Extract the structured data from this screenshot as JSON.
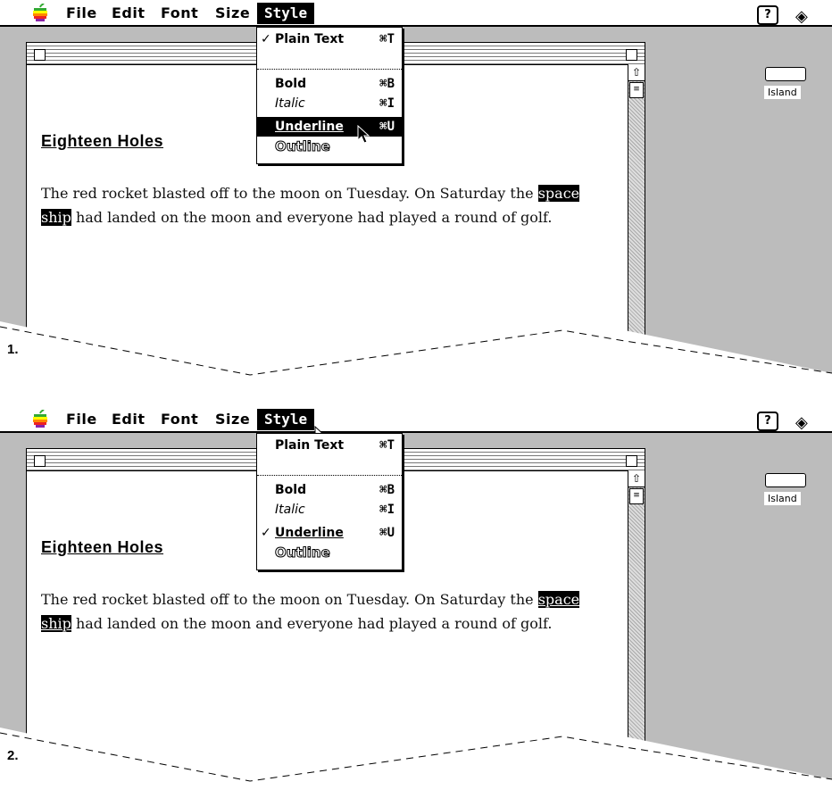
{
  "panels": [
    {
      "number": "1.",
      "menubar": {
        "apple": "apple-menu",
        "file": "File",
        "edit": "Edit",
        "font": "Font",
        "size": "Size",
        "style": "Style"
      },
      "style_menu_open": true,
      "menu": [
        {
          "label": "Plain Text",
          "shortcut": "⌘T",
          "checked": true
        },
        {
          "label": "Bold",
          "shortcut": "⌘B"
        },
        {
          "label": "Italic",
          "shortcut": "⌘I"
        },
        {
          "label": "Underline",
          "shortcut": "⌘U",
          "highlighted": true
        },
        {
          "label": "Outline",
          "shortcut": ""
        }
      ],
      "doc_title": "Eighteen Holes",
      "body_before": "The red rocket blasted off to the moon on Tuesday.  On Saturday the ",
      "body_selected": "space ship",
      "body_after": " had landed on the moon and everyone had played a round of golf.",
      "island_label": "Island"
    },
    {
      "number": "2.",
      "menubar": {
        "apple": "apple-menu",
        "file": "File",
        "edit": "Edit",
        "font": "Font",
        "size": "Size",
        "style": "Style"
      },
      "style_menu_open": false,
      "menu": [
        {
          "label": "Plain Text",
          "shortcut": "⌘T"
        },
        {
          "label": "Bold",
          "shortcut": "⌘B"
        },
        {
          "label": "Italic",
          "shortcut": "⌘I"
        },
        {
          "label": "Underline",
          "shortcut": "⌘U",
          "checked": true
        },
        {
          "label": "Outline",
          "shortcut": ""
        }
      ],
      "doc_title": "Eighteen Holes",
      "body_before": "The red rocket blasted off to the moon on Tuesday.  On Saturday the ",
      "body_selected": "space ship",
      "body_after": " had landed on the moon and everyone had played a round of golf.",
      "island_label": "Island"
    }
  ],
  "help_icon": "?",
  "finder_icon": "finder-icon"
}
